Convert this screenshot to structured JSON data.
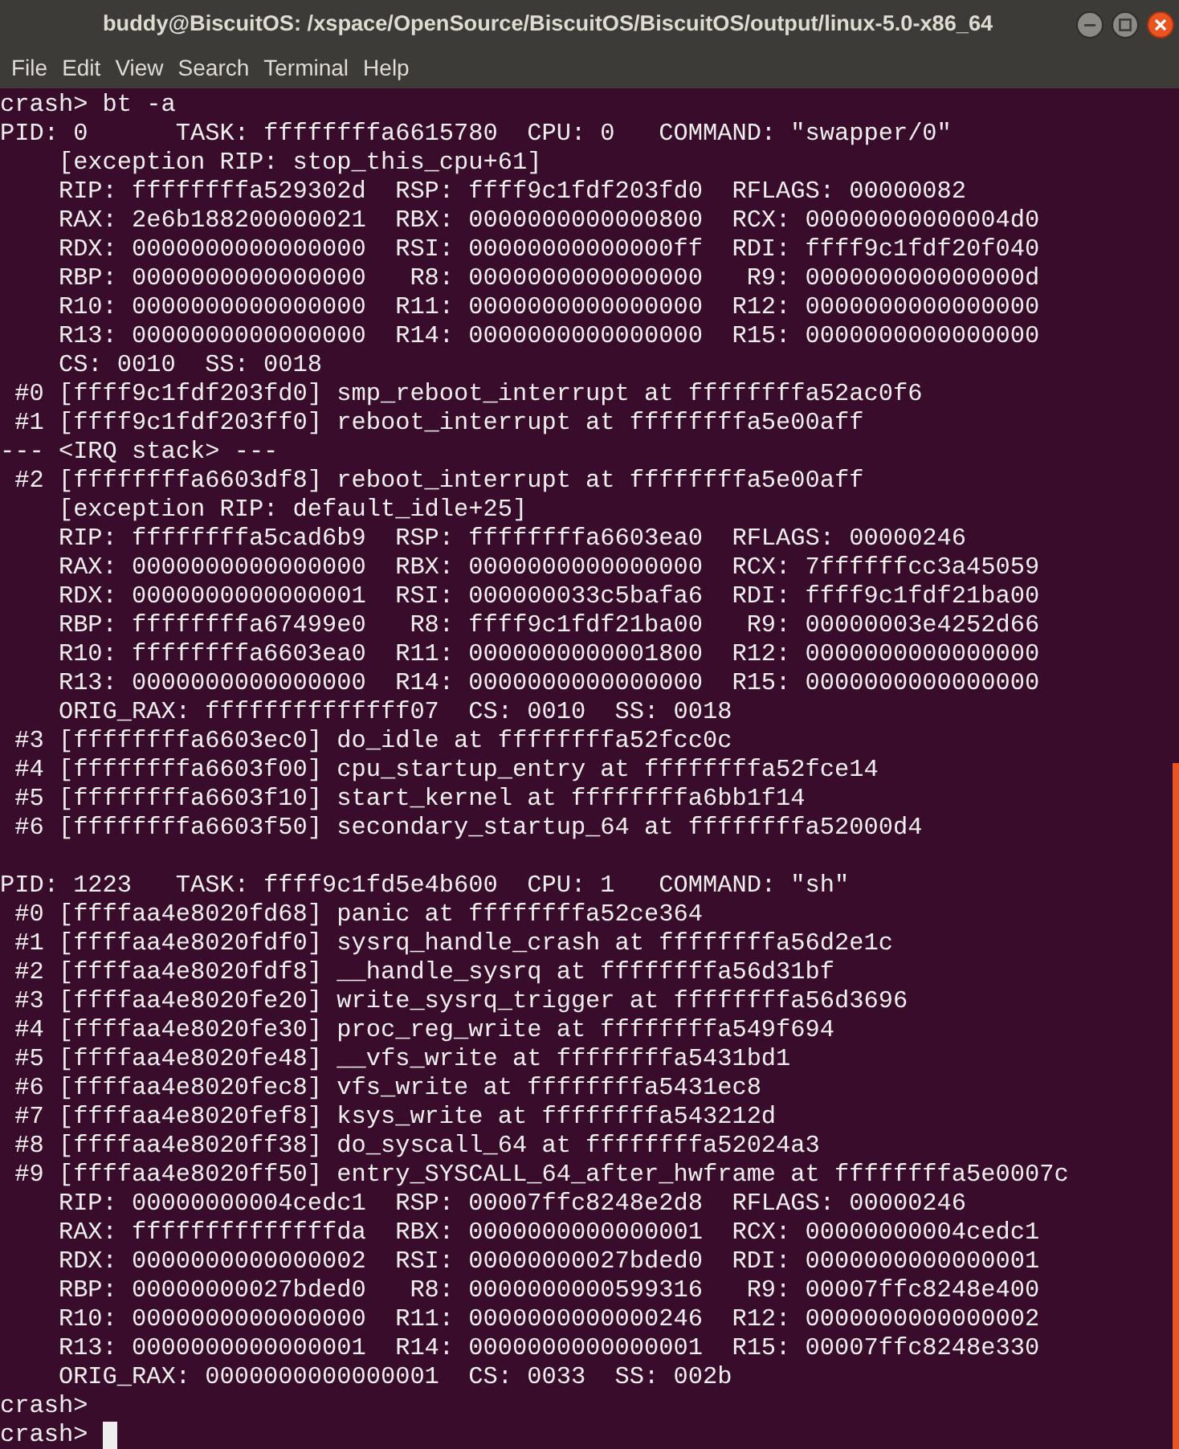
{
  "window": {
    "title": "buddy@BiscuitOS: /xspace/OpenSource/BiscuitOS/BiscuitOS/output/linux-5.0-x86_64"
  },
  "menu": [
    "File",
    "Edit",
    "View",
    "Search",
    "Terminal",
    "Help"
  ],
  "terminal": {
    "sections": [
      [
        "crash> bt -a",
        "PID: 0      TASK: ffffffffa6615780  CPU: 0   COMMAND: \"swapper/0\"",
        "    [exception RIP: stop_this_cpu+61]",
        "    RIP: ffffffffa529302d  RSP: ffff9c1fdf203fd0  RFLAGS: 00000082",
        "    RAX: 2e6b188200000021  RBX: 0000000000000800  RCX: 00000000000004d0",
        "    RDX: 0000000000000000  RSI: 00000000000000ff  RDI: ffff9c1fdf20f040",
        "    RBP: 0000000000000000   R8: 0000000000000000   R9: 000000000000000d",
        "    R10: 0000000000000000  R11: 0000000000000000  R12: 0000000000000000",
        "    R13: 0000000000000000  R14: 0000000000000000  R15: 0000000000000000",
        "    CS: 0010  SS: 0018",
        " #0 [ffff9c1fdf203fd0] smp_reboot_interrupt at ffffffffa52ac0f6",
        " #1 [ffff9c1fdf203ff0] reboot_interrupt at ffffffffa5e00aff",
        "--- <IRQ stack> ---",
        " #2 [ffffffffa6603df8] reboot_interrupt at ffffffffa5e00aff",
        "    [exception RIP: default_idle+25]",
        "    RIP: ffffffffa5cad6b9  RSP: ffffffffa6603ea0  RFLAGS: 00000246",
        "    RAX: 0000000000000000  RBX: 0000000000000000  RCX: 7ffffffcc3a45059",
        "    RDX: 0000000000000001  RSI: 000000033c5bafa6  RDI: ffff9c1fdf21ba00",
        "    RBP: ffffffffa67499e0   R8: ffff9c1fdf21ba00   R9: 00000003e4252d66",
        "    R10: ffffffffa6603ea0  R11: 0000000000001800  R12: 0000000000000000",
        "    R13: 0000000000000000  R14: 0000000000000000  R15: 0000000000000000",
        "    ORIG_RAX: ffffffffffffff07  CS: 0010  SS: 0018",
        " #3 [ffffffffa6603ec0] do_idle at ffffffffa52fcc0c",
        " #4 [ffffffffa6603f00] cpu_startup_entry at ffffffffa52fce14",
        " #5 [ffffffffa6603f10] start_kernel at ffffffffa6bb1f14",
        " #6 [ffffffffa6603f50] secondary_startup_64 at ffffffffa52000d4"
      ],
      [
        "PID: 1223   TASK: ffff9c1fd5e4b600  CPU: 1   COMMAND: \"sh\"",
        " #0 [ffffaa4e8020fd68] panic at ffffffffa52ce364",
        " #1 [ffffaa4e8020fdf0] sysrq_handle_crash at ffffffffa56d2e1c",
        " #2 [ffffaa4e8020fdf8] __handle_sysrq at ffffffffa56d31bf",
        " #3 [ffffaa4e8020fe20] write_sysrq_trigger at ffffffffa56d3696",
        " #4 [ffffaa4e8020fe30] proc_reg_write at ffffffffa549f694",
        " #5 [ffffaa4e8020fe48] __vfs_write at ffffffffa5431bd1",
        " #6 [ffffaa4e8020fec8] vfs_write at ffffffffa5431ec8",
        " #7 [ffffaa4e8020fef8] ksys_write at ffffffffa543212d",
        " #8 [ffffaa4e8020ff38] do_syscall_64 at ffffffffa52024a3",
        " #9 [ffffaa4e8020ff50] entry_SYSCALL_64_after_hwframe at ffffffffa5e0007c",
        "    RIP: 00000000004cedc1  RSP: 00007ffc8248e2d8  RFLAGS: 00000246",
        "    RAX: ffffffffffffffda  RBX: 0000000000000001  RCX: 00000000004cedc1",
        "    RDX: 0000000000000002  RSI: 00000000027bded0  RDI: 0000000000000001",
        "    RBP: 00000000027bded0   R8: 0000000000599316   R9: 00007ffc8248e400",
        "    R10: 0000000000000000  R11: 0000000000000246  R12: 0000000000000002",
        "    R13: 0000000000000001  R14: 0000000000000001  R15: 00007ffc8248e330",
        "    ORIG_RAX: 0000000000000001  CS: 0033  SS: 002b",
        "crash>",
        "crash>"
      ]
    ],
    "cursor": true
  }
}
